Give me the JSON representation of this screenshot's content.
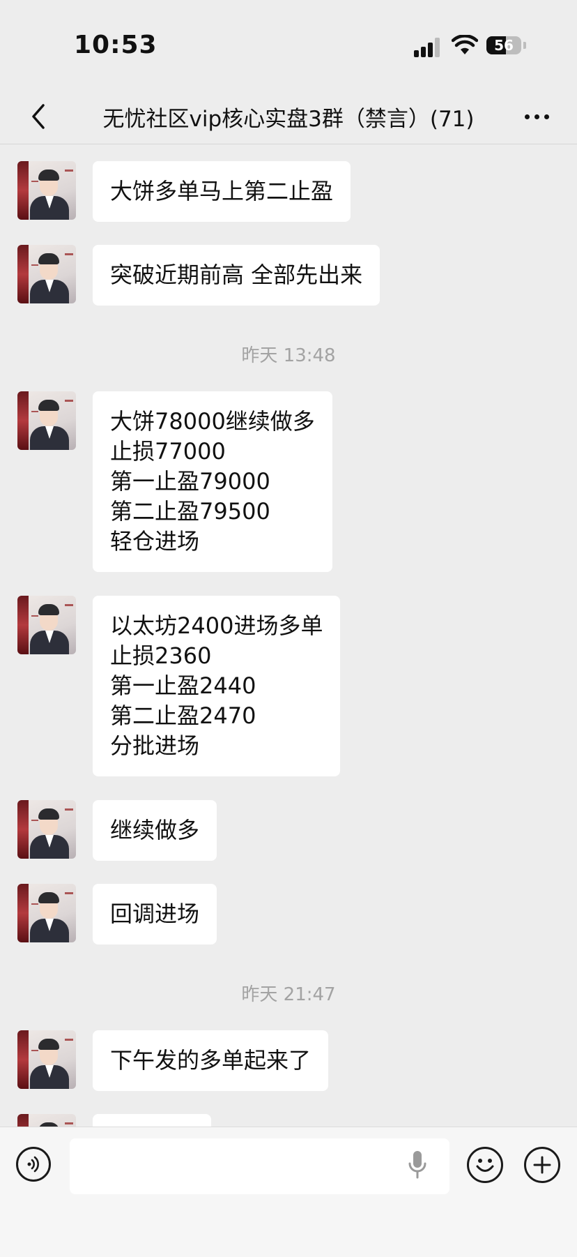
{
  "status": {
    "time": "10:53",
    "battery": "56"
  },
  "header": {
    "title": "无忧社区vip核心实盘3群（禁言）(71)"
  },
  "messages": [
    {
      "text": "大饼多单马上第二止盈"
    },
    {
      "text": "突破近期前高 全部先出来"
    },
    {
      "text": "大饼78000继续做多\n止损77000\n第一止盈79000\n第二止盈79500\n轻仓进场"
    },
    {
      "text": "以太坊2400进场多单\n止损2360\n第一止盈2440\n第二止盈2470\n分批进场"
    },
    {
      "text": "继续做多"
    },
    {
      "text": "回调进场"
    },
    {
      "text": "下午发的多单起来了"
    }
  ],
  "timestamps": [
    "昨天 13:48",
    "昨天 21:47"
  ],
  "icons": {
    "back": "chevron-left-icon",
    "more": "more-dots-icon",
    "voice": "voice-icon",
    "mic": "microphone-icon",
    "emoji": "emoji-icon",
    "plus": "plus-icon"
  },
  "colors": {
    "background": "#ededed",
    "bubble": "#ffffff",
    "timestamp": "#a3a3a3"
  }
}
